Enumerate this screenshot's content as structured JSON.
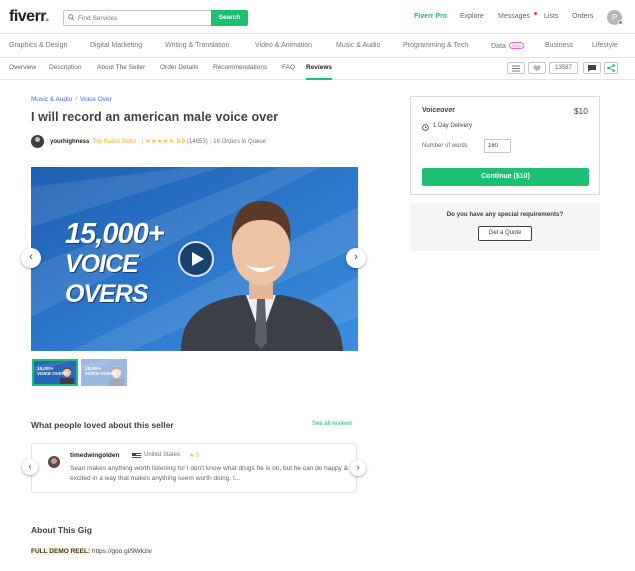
{
  "header": {
    "logo_text": "fiverr",
    "logo_dot": ".",
    "search_placeholder": "Find Services",
    "search_button": "Search",
    "nav": {
      "pro": "Fiverr Pro",
      "explore": "Explore",
      "messages": "Messages",
      "lists": "Lists",
      "orders": "Orders"
    },
    "avatar_letter": "P"
  },
  "categories": [
    "Graphics & Design",
    "Digital Marketing",
    "Writing & Translation",
    "Video & Animation",
    "Music & Audio",
    "Programming & Tech",
    "Data",
    "Business",
    "Lifestyle"
  ],
  "data_badge": "NEW",
  "subnav": [
    "Overview",
    "Description",
    "About The Seller",
    "Order Details",
    "Recommendations",
    "FAQ",
    "Reviews"
  ],
  "likes_count": "13587",
  "breadcrumb": {
    "first": "Music & Audio",
    "sep": "/",
    "second": "Voice Over"
  },
  "gig_title": "I will record an american male voice over",
  "seller": {
    "name": "yourhighness",
    "level": "Top Rated Seller",
    "stars": "★★★★★",
    "rating": "5.0",
    "reviews": "(14653)",
    "queue": "16 Orders in Queue",
    "sep": "|"
  },
  "hero": {
    "line1": "15,000+",
    "line2": "VOICE OVERS"
  },
  "thumbs": [
    {
      "line1": "15,000+",
      "line2": "VOICE OVERS"
    },
    {
      "line1": "15,000+",
      "line2": "VOICE OVERS"
    }
  ],
  "loved": {
    "heading": "What people loved about this seller",
    "see_all": "See all reviews"
  },
  "review": {
    "name": "timedwingolden",
    "country": "United States",
    "star": "★ 5",
    "text": "Sean makes anything worth listening to! I don't know what drugs he is on, but he can do happy & excited in a way that makes anything seem worth doing. I..."
  },
  "about": {
    "heading": "About This Gig",
    "demo_label": "FULL DEMO REEL:",
    "demo_link": " https://goo.gl/9Wkziv"
  },
  "package": {
    "name": "Voiceover",
    "price": "$10",
    "delivery": "1 Day Delivery",
    "words_label": "Number of words",
    "words_value": "160",
    "continue": "Continue ($10)"
  },
  "requirements": {
    "question": "Do you have any special requirements?",
    "button": "Get a Quote"
  },
  "colors": {
    "brand_green": "#1dbf73",
    "star_yellow": "#ffb33e",
    "link_blue": "#446ee7"
  }
}
